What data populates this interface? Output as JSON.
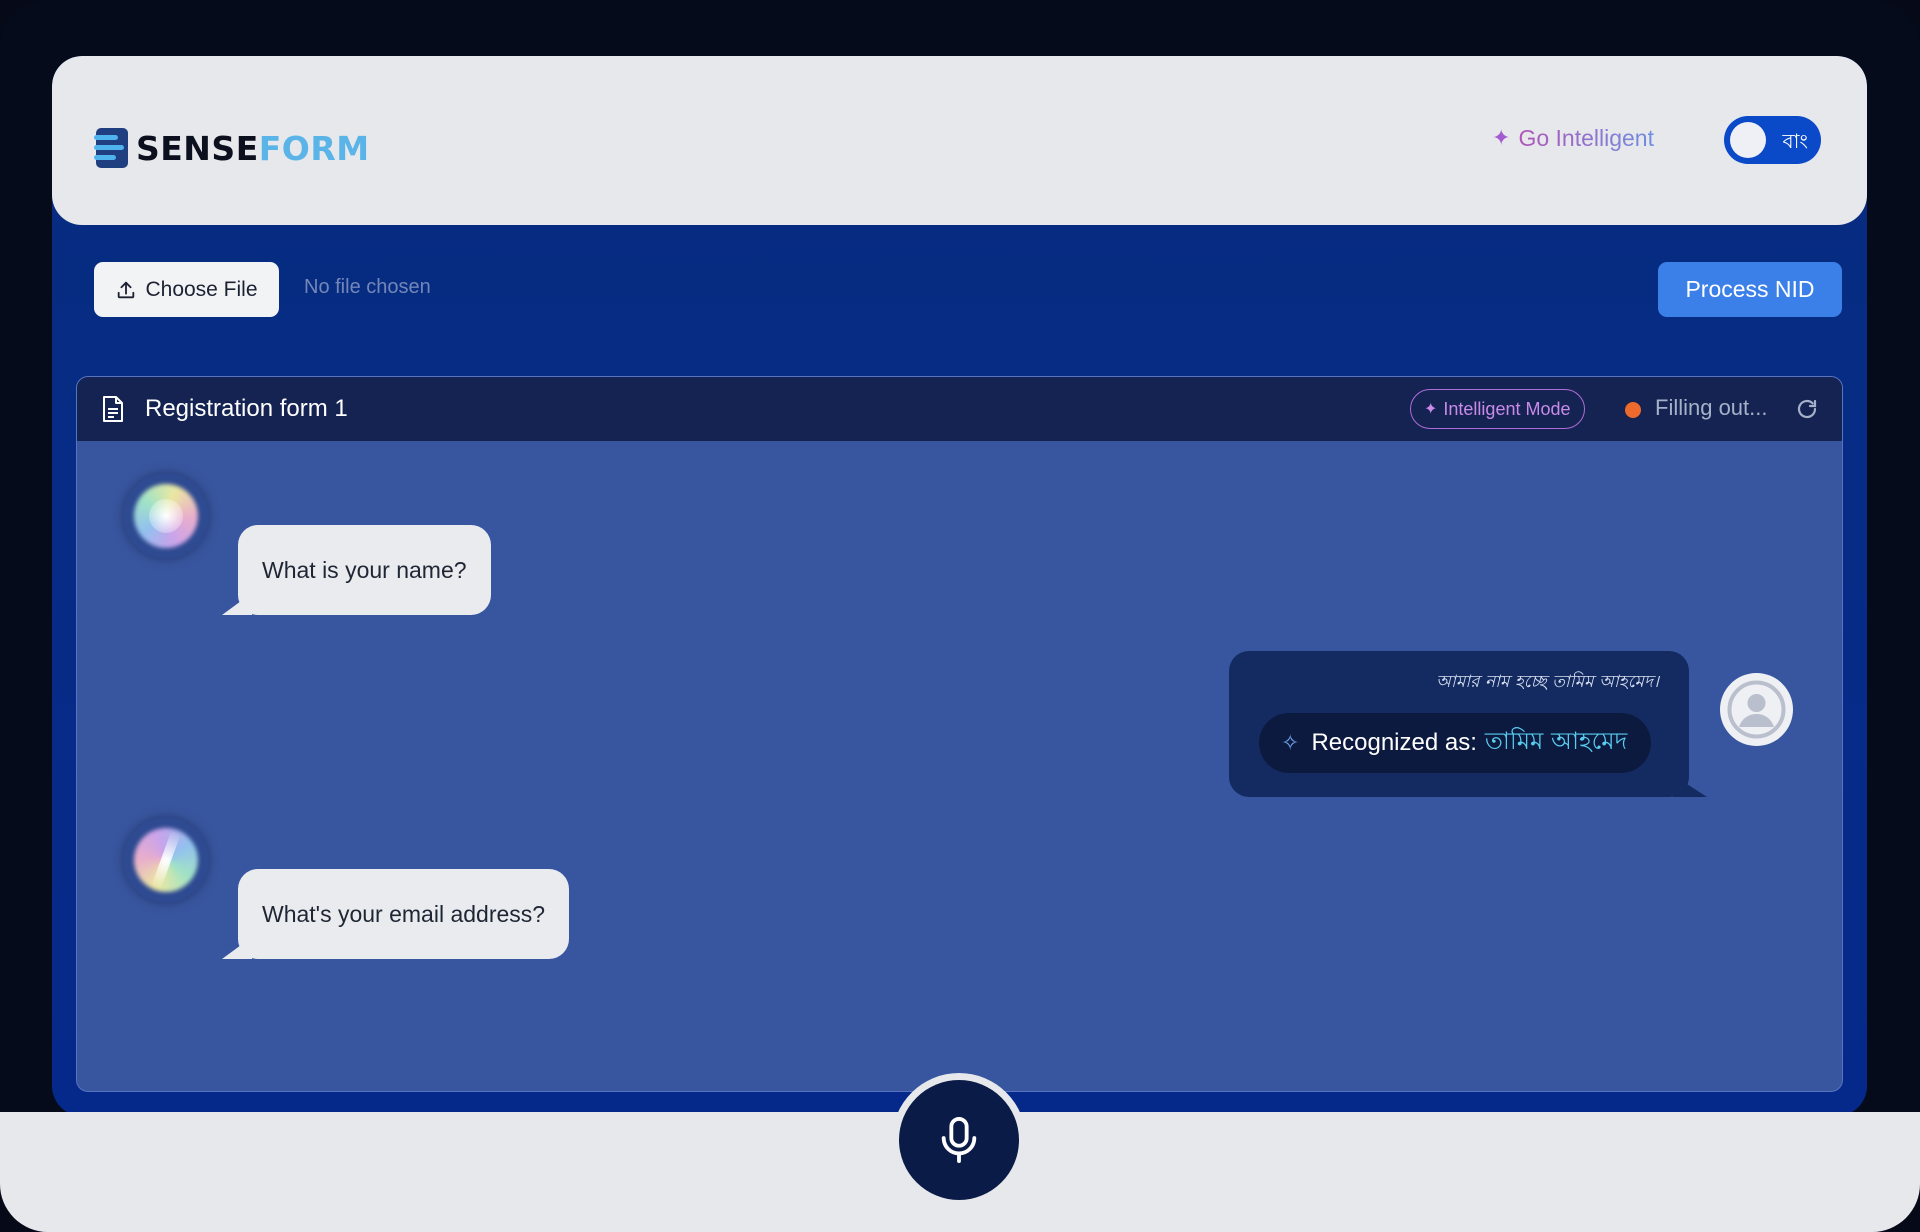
{
  "app": {
    "logo_sense": "SENSE",
    "logo_form": "FORM"
  },
  "header": {
    "go_intelligent": "Go Intelligent",
    "language_toggle": "বাং"
  },
  "file_row": {
    "choose_file": "Choose File",
    "no_file": "No file chosen",
    "process_nid": "Process NID"
  },
  "form": {
    "title": "Registration form 1",
    "mode_badge": "Intelligent Mode",
    "status": "Filling out...",
    "status_color": "#ec6a2b"
  },
  "chat": {
    "q1": "What is your name?",
    "answer_raw": "আমার নাম হচ্ছে তামিম আহমেদ।",
    "recognized_label": "Recognized as:",
    "recognized_value": "তামিম আহমেদ",
    "q2": "What's your email address?"
  },
  "colors": {
    "accent": "#3b7fe8",
    "panel": "#38569f",
    "header_bg": "#e7e8ec"
  },
  "icons": {
    "mic": "microphone-icon",
    "upload": "upload-icon",
    "document": "document-icon",
    "refresh": "refresh-icon",
    "sparkle": "sparkle-icon",
    "user": "user-icon"
  }
}
